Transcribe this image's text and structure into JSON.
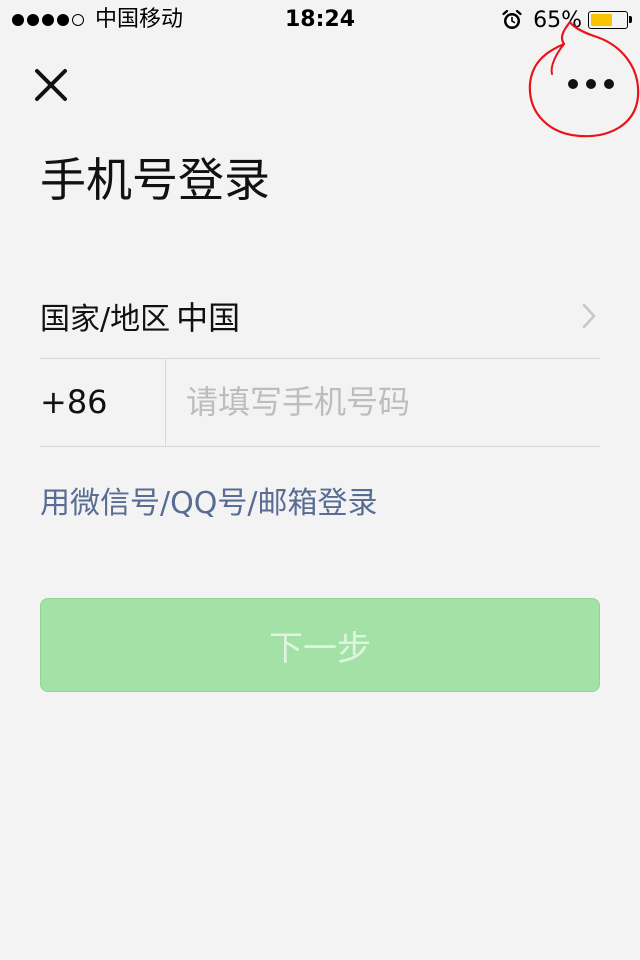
{
  "status_bar": {
    "carrier": "中国移动",
    "time": "18:24",
    "battery_percent": "65%",
    "battery_level": 0.65,
    "signal_bars_filled": 4,
    "signal_bars_total": 5
  },
  "header": {
    "close_icon": "close-icon",
    "more_icon": "more-horizontal-icon"
  },
  "page": {
    "title": "手机号登录"
  },
  "form": {
    "region_label": "国家/地区",
    "region_value": "中国",
    "country_code": "+86",
    "phone_value": "",
    "phone_placeholder": "请填写手机号码"
  },
  "alt_login_label": "用微信号/QQ号/邮箱登录",
  "next_button_label": "下一步",
  "colors": {
    "background": "#f3f3f3",
    "link": "#586c94",
    "button_disabled": "#a3e1a6",
    "battery": "#f6c400",
    "annotation": "#e8141c"
  }
}
